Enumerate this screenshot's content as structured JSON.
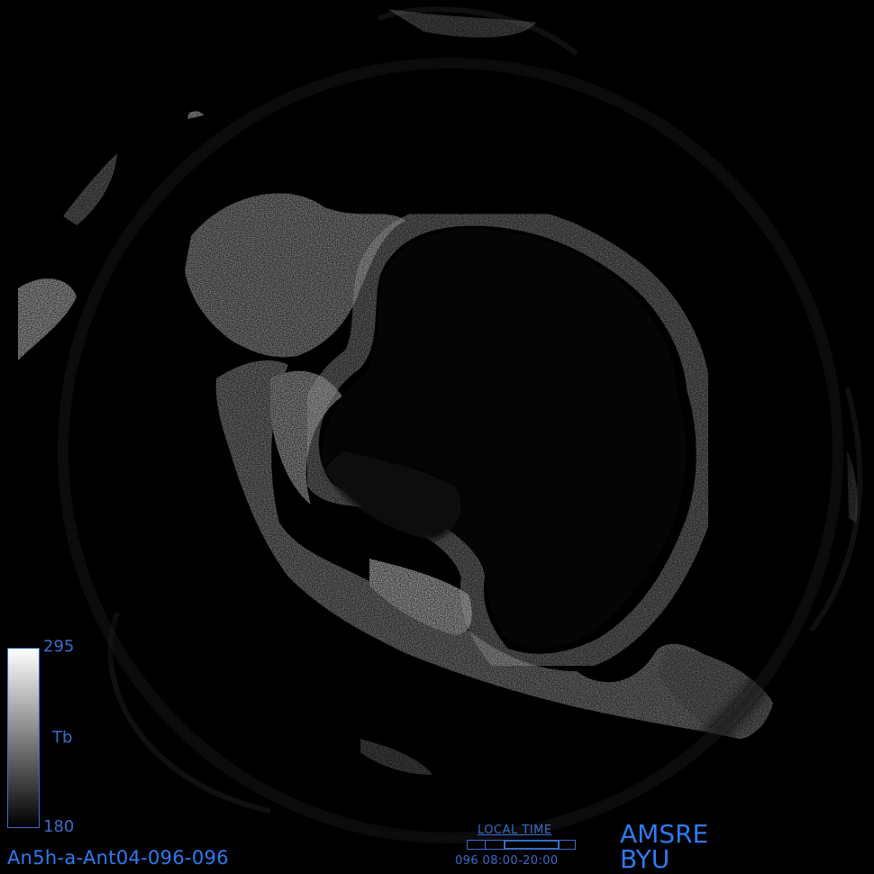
{
  "colors": {
    "label_blue": "#3a6cc8",
    "title_blue": "#2f7af0",
    "background": "#000000"
  },
  "colorbar": {
    "max": "295",
    "min": "180",
    "units": "Tb"
  },
  "image_id": "An5h-a-Ant04-096-096",
  "local_time": {
    "title": "LOCAL TIME",
    "range": "096  08:00-20:00"
  },
  "sensor": "AMSRE",
  "institution": "BYU"
}
